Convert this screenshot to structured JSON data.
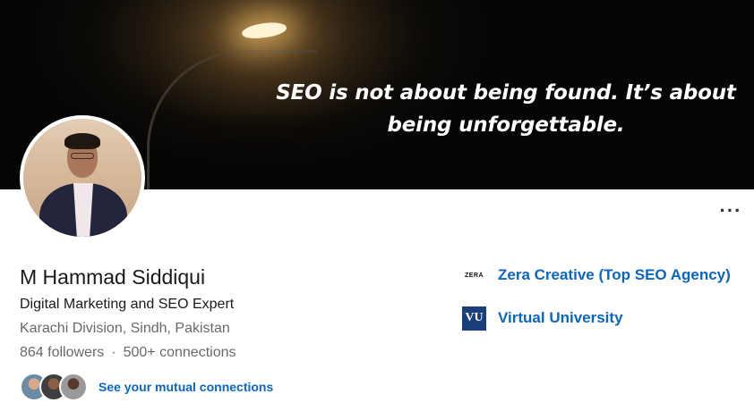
{
  "banner": {
    "quote": "SEO is not about being found. It’s about being unforgettable."
  },
  "profile": {
    "name": "M Hammad Siddiqui",
    "headline": "Digital Marketing and SEO Expert",
    "location": "Karachi Division, Sindh, Pakistan",
    "followers": "864 followers",
    "separator": "·",
    "connections": "500+ connections"
  },
  "more_menu": {
    "label": "···"
  },
  "mutual": {
    "label": "See your mutual connections"
  },
  "experience": [
    {
      "name": "Zera Creative (Top SEO Agency)",
      "logo_text": "ZERA"
    },
    {
      "name": "Virtual University",
      "logo_text": "VU"
    }
  ],
  "colors": {
    "link": "#0a66c2",
    "vu_logo": "#1a3d7c"
  }
}
